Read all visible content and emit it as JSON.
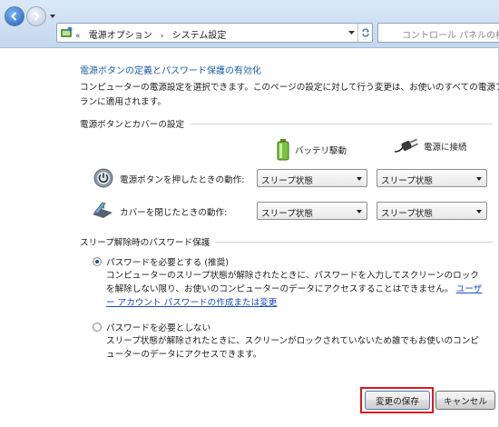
{
  "nav": {
    "breadcrumbs": [
      "電源オプション",
      "システム設定"
    ],
    "breadcrumb_prefix": "«",
    "breadcrumb_sep": "›",
    "search_placeholder": "コントロール パネルの検"
  },
  "page": {
    "title": "電源ボタンの定義とパスワード保護の有効化",
    "description": "コンピューターの電源設定を選択できます。このページの設定に対して行う変更は、お使いのすべての電源プランに適用されます。"
  },
  "power_buttons": {
    "group_label": "電源ボタンとカバーの設定",
    "battery_label": "バッテリ駆動",
    "plugged_label": "電源に接続",
    "rows": [
      {
        "label": "電源ボタンを押したときの動作:",
        "battery": "スリープ状態",
        "plugged": "スリープ状態",
        "icon": "power-button-icon"
      },
      {
        "label": "カバーを閉じたときの動作:",
        "battery": "スリープ状態",
        "plugged": "スリープ状態",
        "icon": "laptop-lid-icon"
      }
    ]
  },
  "password": {
    "group_label": "スリープ解除時のパスワード保護",
    "require_label": "パスワードを必要とする (推奨)",
    "require_desc": "コンピューターのスリープ状態が解除されたときに、パスワードを入力してスクリーンのロックを解除しない限り、お使いのコンピューターのデータにアクセスすることはできません。",
    "require_link": "ユーザー アカウント パスワードの作成または変更",
    "require_checked": true,
    "no_require_label": "パスワードを必要としない",
    "no_require_desc": "スリープ状態が解除されたときに、スクリーンがロックされていないため誰でもお使いのコンピューターのデータにアクセスできます。",
    "no_require_checked": false
  },
  "buttons": {
    "save": "変更の保存",
    "cancel": "キャンセル"
  },
  "colors": {
    "highlight": "#e0161c",
    "link": "#1a4bb8",
    "title": "#1e5da8"
  }
}
